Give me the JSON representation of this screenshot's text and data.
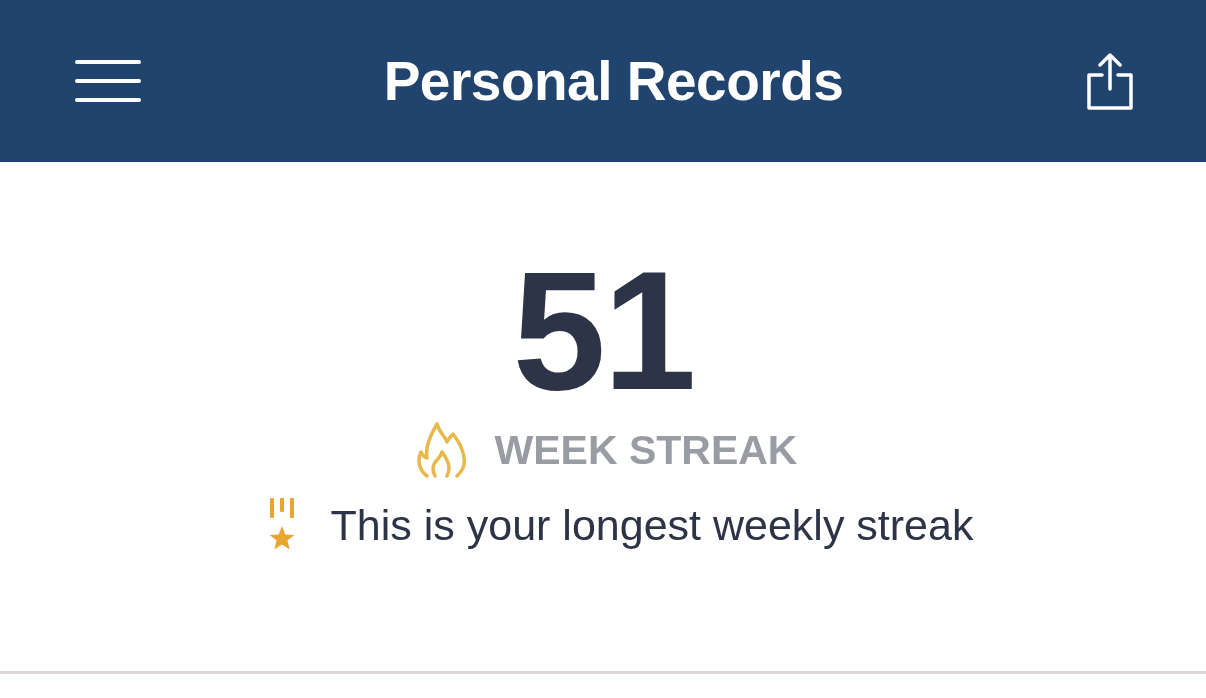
{
  "header": {
    "title": "Personal Records"
  },
  "streak": {
    "value": "51",
    "label": "WEEK STREAK",
    "note": "This is your longest weekly streak"
  }
}
